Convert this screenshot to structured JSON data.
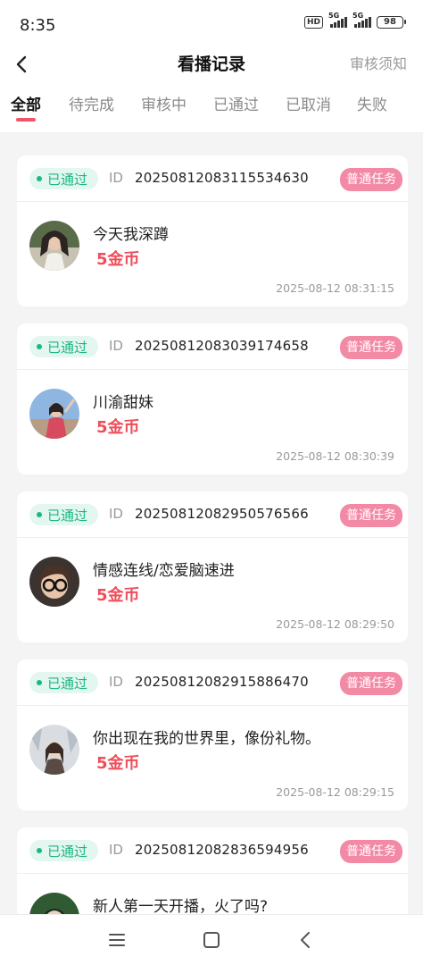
{
  "status_bar": {
    "time": "8:35",
    "hd": "HD",
    "signal1": "5G",
    "signal2": "5G",
    "battery": "98"
  },
  "header": {
    "title": "看播记录",
    "rules_link": "审核须知"
  },
  "tabs": [
    {
      "label": "全部",
      "active": true
    },
    {
      "label": "待完成",
      "active": false
    },
    {
      "label": "审核中",
      "active": false
    },
    {
      "label": "已通过",
      "active": false
    },
    {
      "label": "已取消",
      "active": false
    },
    {
      "label": "失败",
      "active": false
    }
  ],
  "records": [
    {
      "status": "已通过",
      "id_label": "ID",
      "id": "20250812083115534630",
      "badge": "普通任务",
      "name": "今天我深蹲",
      "reward": "5金币",
      "time": "2025-08-12 08:31:15"
    },
    {
      "status": "已通过",
      "id_label": "ID",
      "id": "20250812083039174658",
      "badge": "普通任务",
      "name": "川渝甜妹",
      "reward": "5金币",
      "time": "2025-08-12 08:30:39"
    },
    {
      "status": "已通过",
      "id_label": "ID",
      "id": "20250812082950576566",
      "badge": "普通任务",
      "name": "情感连线/恋爱脑速进",
      "reward": "5金币",
      "time": "2025-08-12 08:29:50"
    },
    {
      "status": "已通过",
      "id_label": "ID",
      "id": "20250812082915886470",
      "badge": "普通任务",
      "name": "你出现在我的世界里，像份礼物。",
      "reward": "5金币",
      "time": "2025-08-12 08:29:15"
    },
    {
      "status": "已通过",
      "id_label": "ID",
      "id": "20250812082836594956",
      "badge": "普通任务",
      "name": "新人第一天开播，火了吗?",
      "reward": "",
      "time": ""
    }
  ],
  "colors": {
    "accent": "#f0546a",
    "status_green": "#1bb882",
    "badge_pink": "#f28aa6",
    "reward_red": "#ef4d5a"
  }
}
